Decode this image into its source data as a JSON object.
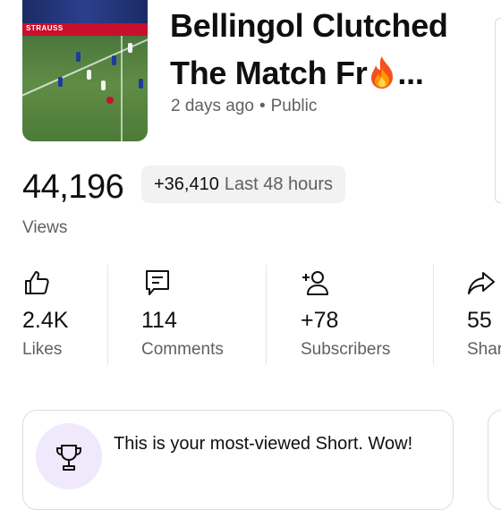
{
  "video": {
    "title_line1": "Bellingol Clutched",
    "title_line2": "The Match Fr",
    "title_ellipsis": "...",
    "uploaded": "2 days ago",
    "visibility": "Public",
    "thumbnail_banner": "STRAUSS"
  },
  "views": {
    "count": "44,196",
    "delta": "+36,410",
    "period": "Last 48 hours",
    "label": "Views"
  },
  "stats": [
    {
      "value": "2.4K",
      "label": "Likes",
      "icon": "thumbs-up-icon"
    },
    {
      "value": "114",
      "label": "Comments",
      "icon": "comment-icon"
    },
    {
      "value": "+78",
      "label": "Subscribers",
      "icon": "add-person-icon"
    },
    {
      "value": "55",
      "label": "Shar",
      "icon": "share-icon"
    }
  ],
  "insight": {
    "message": "This is your most-viewed Short. Wow!",
    "icon": "trophy-icon"
  },
  "colors": {
    "text_primary": "#0f0f0f",
    "text_secondary": "#606060",
    "chip_bg": "#f2f2f2",
    "trophy_bg": "#efe9fb"
  }
}
